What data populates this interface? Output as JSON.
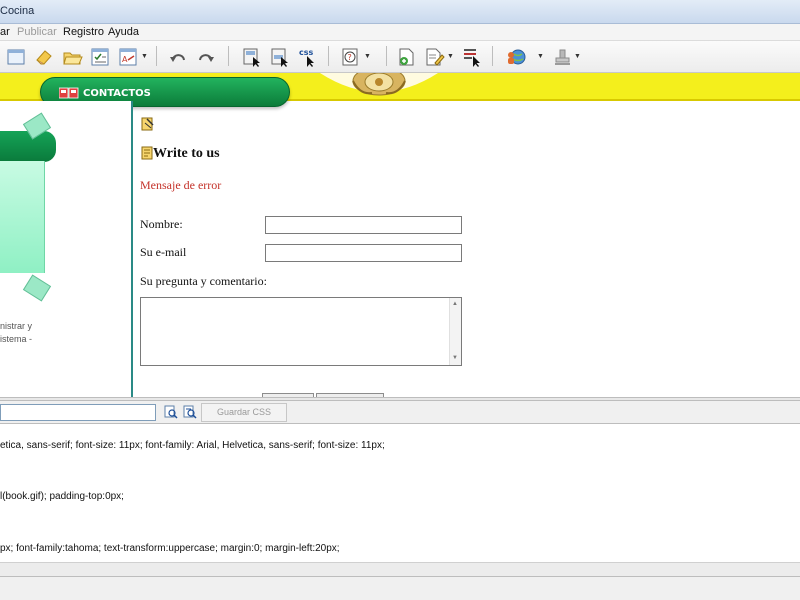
{
  "window": {
    "title_fragment": "Cocina"
  },
  "menu": {
    "items": [
      {
        "label": "ar",
        "disabled": false
      },
      {
        "label": "Publicar",
        "disabled": true
      },
      {
        "label": "Registro",
        "disabled": false
      },
      {
        "label": "Ayuda",
        "disabled": false
      }
    ]
  },
  "toolbar": {
    "icons": [
      "window-icon",
      "eraser-icon",
      "open-folder-icon",
      "checklist-icon",
      "spellcheck-icon",
      "undo-icon",
      "redo-icon",
      "select-page-icon",
      "select-element-icon",
      "css-select-icon",
      "help-icon",
      "new-page-icon",
      "edit-page-icon",
      "list-cursor-icon",
      "users-globe-icon",
      "stamp-icon"
    ],
    "css_icon_text": "css"
  },
  "preview": {
    "nav_tab_label": "CONTACTOS",
    "left_text": [
      "nistrar y",
      "istema -"
    ],
    "heading": "Write to us",
    "error_message": "Mensaje de error",
    "form": {
      "name_label": "Nombre:",
      "email_label": "Su e-mail",
      "comment_label": "Su pregunta y comentario:",
      "name_value": "",
      "email_value": "",
      "comment_value": ""
    },
    "colors": {
      "yellow_band": "#f4ef1c",
      "green_tab": "#0c7c3a",
      "error_text": "#c4322a",
      "divider": "#2a8a86"
    }
  },
  "css_editor": {
    "selector_value": "",
    "save_label": "Guardar CSS",
    "lines": [
      "etica, sans-serif; font-size: 11px; font-family: Arial, Helvetica, sans-serif; font-size: 11px;",
      "l(book.gif); padding-top:0px;",
      "px; font-family:tahoma; text-transform:uppercase; margin:0; margin-left:20px;"
    ]
  }
}
